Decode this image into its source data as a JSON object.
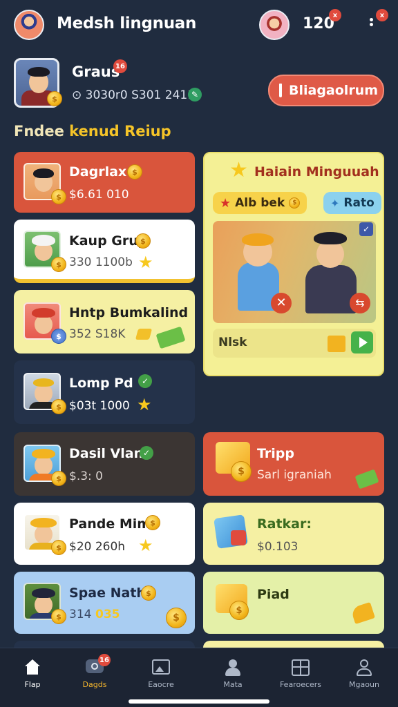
{
  "header": {
    "title": "Medsh lingnuan",
    "coins": "120",
    "coins_badge": "x",
    "menu_badge": "x"
  },
  "profile": {
    "name": "Graus",
    "name_badge": "16",
    "stats": "⊙ 3030r0 S301 2411",
    "cta_label": "Bliagaolrum"
  },
  "section": {
    "title_part1": "Fndee",
    "title_part2": "kenud Reiup"
  },
  "cards_left": [
    {
      "name": "Dagrlax",
      "sub": "$6.61 010",
      "bg": "#d9553c"
    },
    {
      "name": "Kaup Grup",
      "sub": "330 1100b",
      "bg": "#ffffff"
    },
    {
      "name": "Hntp Bumkalind",
      "sub": "352 S18K",
      "bg": "#f5f0a3"
    },
    {
      "name": "Lomp Pd",
      "sub": "$03t 1000",
      "bg": "#24324a"
    },
    {
      "name": "Dasil Vlan",
      "sub": "$.3: 0",
      "bg": "#3b3533"
    },
    {
      "name": "Pande Mim",
      "sub": "$20 260h",
      "bg": "#ffffff"
    },
    {
      "name": "Spae Nath",
      "sub": "314",
      "sub2": "035",
      "bg": "#a9cdf2"
    }
  ],
  "feature": {
    "title": "Haiain Minguuah",
    "pill_left": "Alb bek",
    "pill_right": "Rato",
    "footer_text": "Nlsk"
  },
  "cards_right": [
    {
      "name": "Tripp",
      "sub": "Sarl igraniah",
      "bg": "#d9553c"
    },
    {
      "name": "Ratkar:",
      "sub": "$0.103",
      "bg": "#f5f0a3"
    },
    {
      "name": "Piad",
      "sub": "",
      "bg": "#e4f0a8"
    }
  ],
  "nav": [
    {
      "label": "Flap",
      "icon": "home-icon"
    },
    {
      "label": "Dagds",
      "icon": "chat-icon",
      "badge": "16"
    },
    {
      "label": "Eaocre",
      "icon": "image-icon"
    },
    {
      "label": "Mata",
      "icon": "person-icon"
    },
    {
      "label": "Fearoecers",
      "icon": "grid-icon"
    },
    {
      "label": "Mgaoun",
      "icon": "profile-icon"
    }
  ]
}
